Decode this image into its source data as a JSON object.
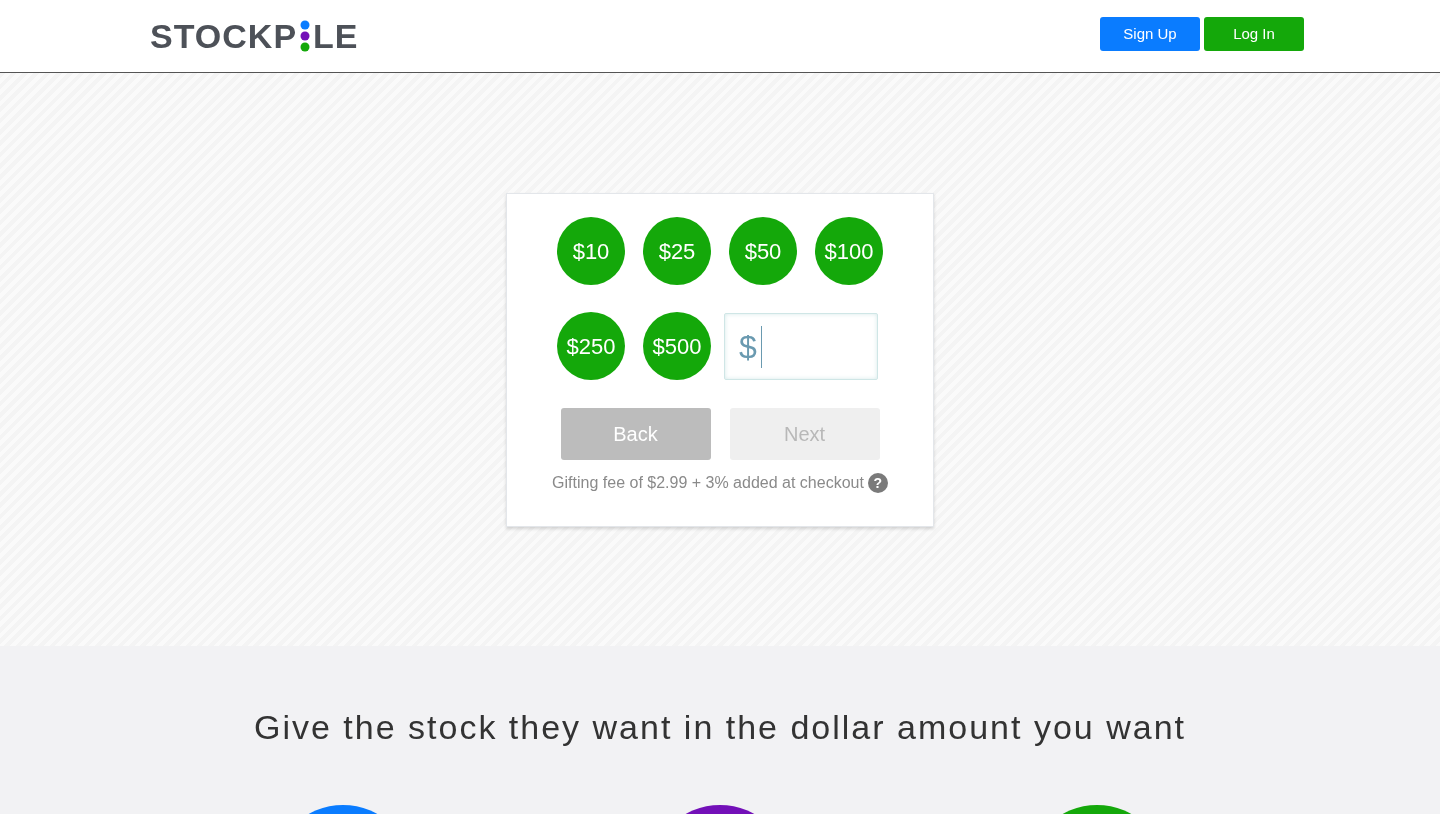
{
  "header": {
    "logo": {
      "before": "STOCKP",
      "after": "LE"
    },
    "buttons": [
      {
        "label": "Sign Up",
        "kind": "primary"
      },
      {
        "label": "Log In",
        "kind": "success"
      }
    ]
  },
  "gift_card": {
    "amounts": [
      "$10",
      "$25",
      "$50",
      "$100",
      "$250",
      "$500"
    ],
    "custom_amount": {
      "prefix": "$"
    },
    "buttons": [
      {
        "label": "Back",
        "disabled": false
      },
      {
        "label": "Next",
        "disabled": true
      }
    ],
    "fee_note": "Gifting fee of $2.99 + 3% added at checkout",
    "help_icon": "?"
  },
  "features": {
    "heading": "Give the stock they want in the dollar amount you want",
    "items": [
      {
        "color": "#0a7cff"
      },
      {
        "color": "#7310b8"
      },
      {
        "color": "#14a80a"
      }
    ]
  }
}
